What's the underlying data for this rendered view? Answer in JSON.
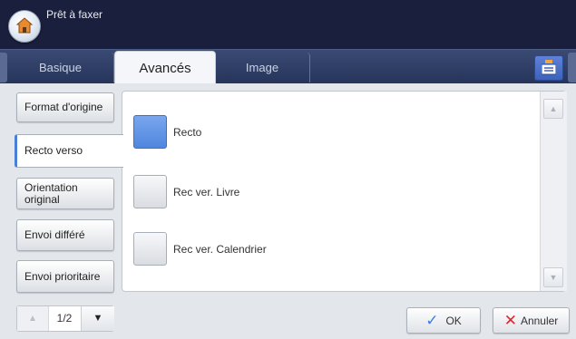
{
  "header": {
    "status": "Prêt à faxer",
    "home_icon": "home-icon"
  },
  "tabs": [
    {
      "label": "Basique",
      "active": false
    },
    {
      "label": "Avancés",
      "active": true
    },
    {
      "label": "Image",
      "active": false
    }
  ],
  "job_status_icon": "job-status-icon",
  "sidebar": {
    "items": [
      {
        "label": "Format d'origine",
        "active": false
      },
      {
        "label": "Recto verso",
        "active": true
      },
      {
        "label": "Orientation\noriginal",
        "active": false
      },
      {
        "label": "Envoi différé",
        "active": false
      },
      {
        "label": "Envoi prioritaire",
        "active": false
      }
    ]
  },
  "options": [
    {
      "label": "Recto",
      "selected": true
    },
    {
      "label": "Rec ver. Livre",
      "selected": false
    },
    {
      "label": "Rec ver. Calendrier",
      "selected": false
    }
  ],
  "pager": {
    "page": "1/2"
  },
  "actions": {
    "ok": "OK",
    "cancel": "Annuler"
  },
  "colors": {
    "accent": "#4f86de",
    "header_bg": "#1a1f3d",
    "tab_bar": "#2e3d66",
    "cancel_x": "#e0262b",
    "ok_check": "#3f7fd9"
  }
}
